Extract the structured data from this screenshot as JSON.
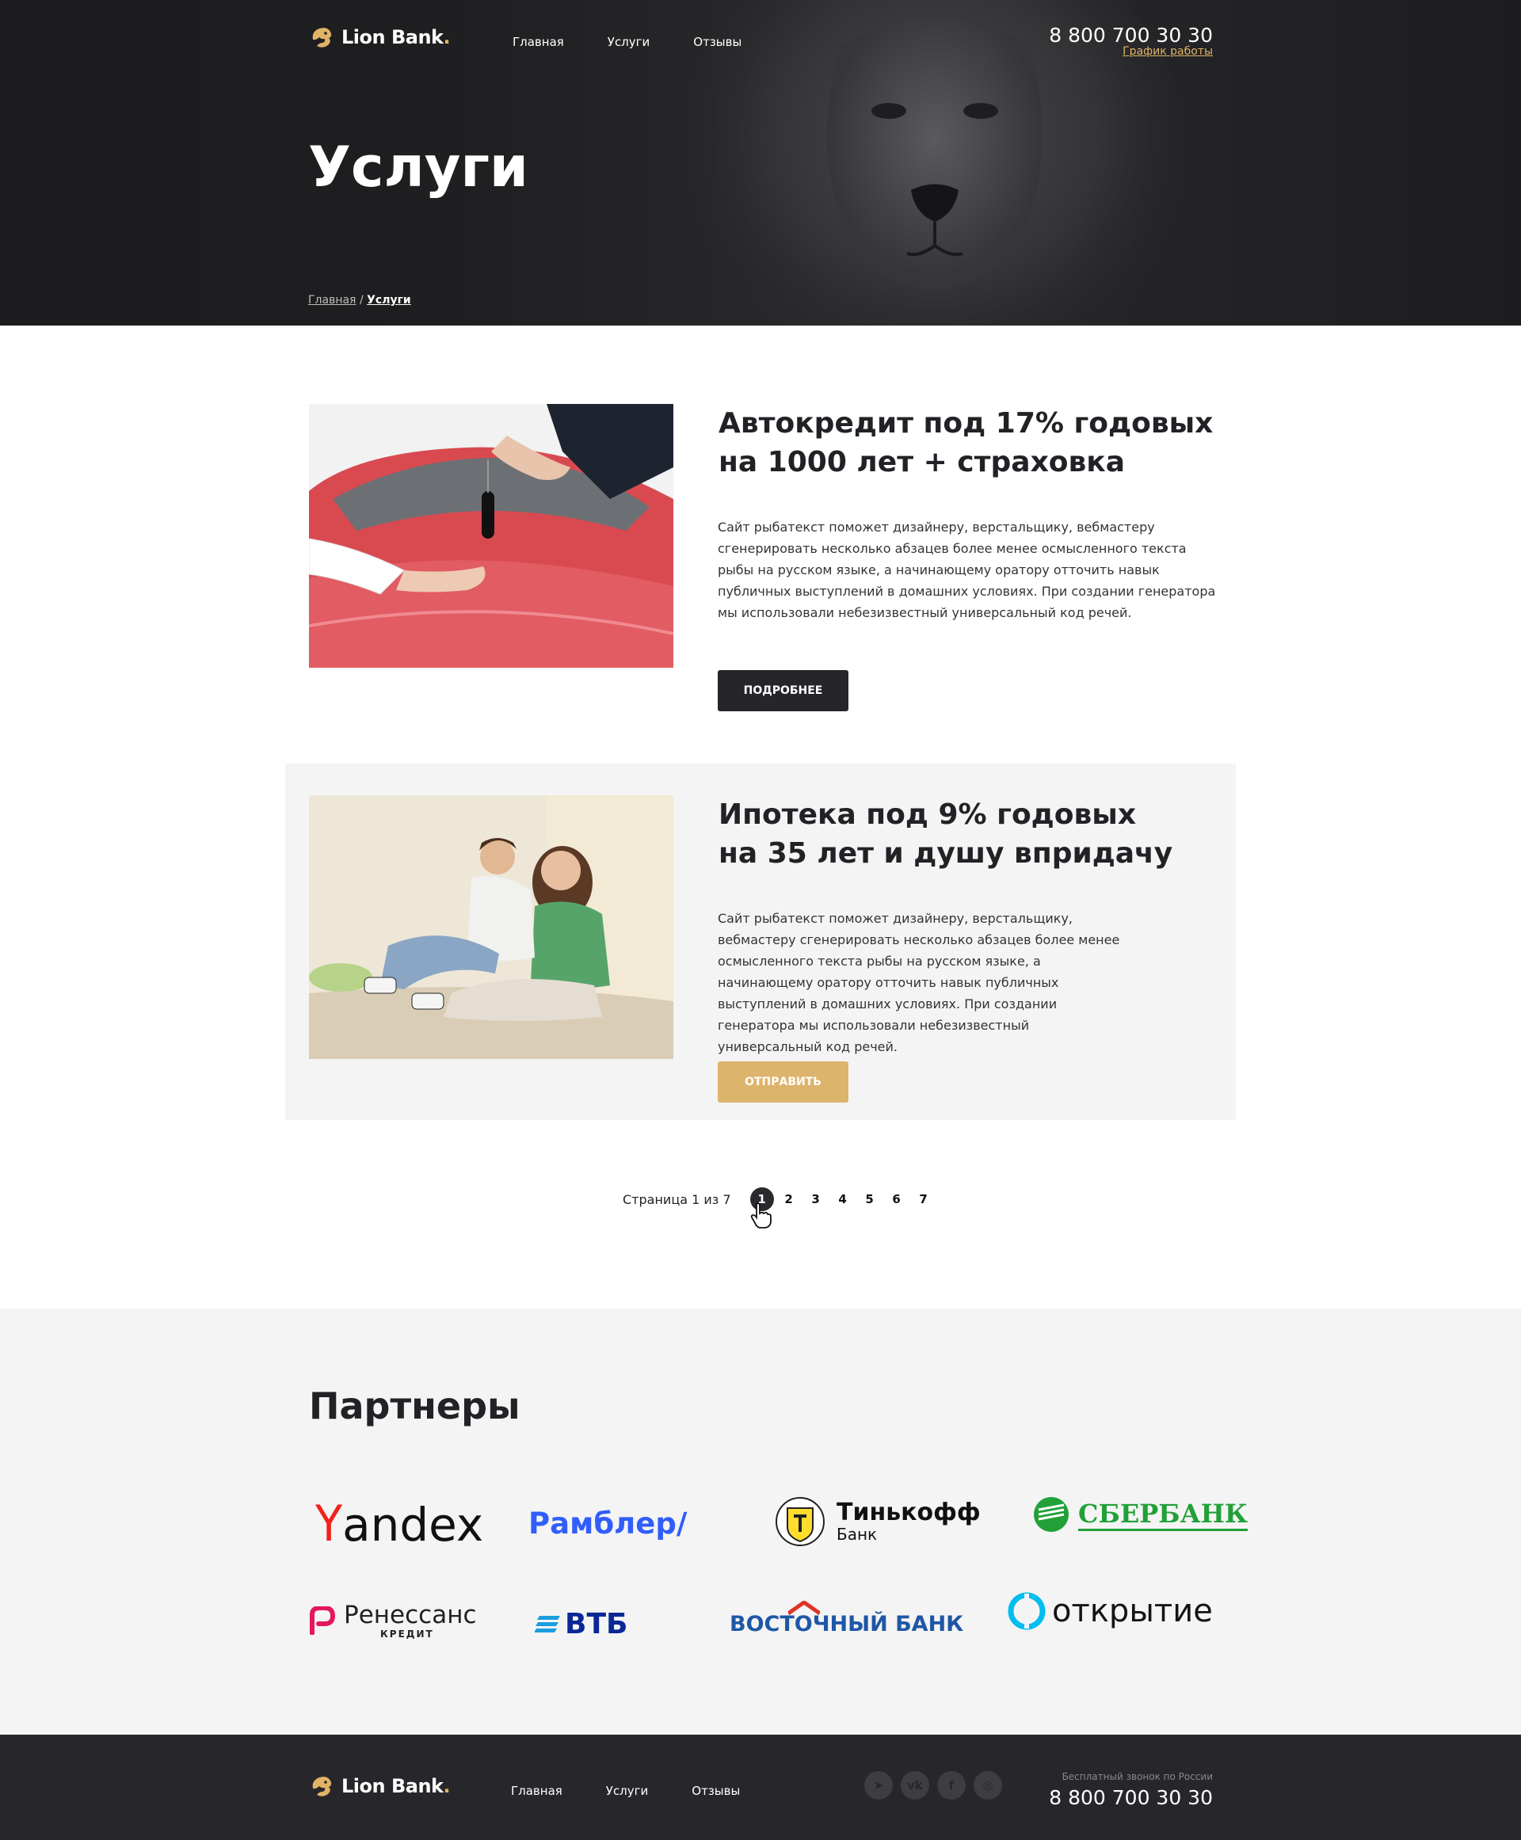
{
  "brand": {
    "name": "Lion Bank",
    "dot": ".",
    "accent": "#e0b366"
  },
  "header": {
    "nav": [
      "Главная",
      "Услуги",
      "Отзывы"
    ],
    "phone": "8 800 700 30 30",
    "schedule_link": "График работы"
  },
  "hero": {
    "title": "Услуги",
    "breadcrumb": {
      "home": "Главная",
      "separator": "/",
      "current": "Услуги"
    }
  },
  "services": [
    {
      "title": "Автокредит под 17% годовых\nна 1000 лет + страховка",
      "text": "Сайт рыбатекст поможет дизайнеру, верстальщику, вебмастеру сгенерировать несколько абзацев более менее осмысленного текста рыбы на русском языке, а начинающему оратору отточить навык публичных выступлений в домашних условиях. При создании генератора мы использовали небезизвестный универсальный код речей.",
      "button": "Подробнее",
      "button_color": "#26262a"
    },
    {
      "title": "Ипотека под 9% годовых\nна 35 лет и душу впридачу",
      "text": "Сайт рыбатекст поможет дизайнеру, верстальщику, вебмастеру сгенерировать несколько абзацев более менее осмысленного текста рыбы на русском языке, а начинающему оратору отточить навык публичных выступлений в домашних условиях. При создании генератора мы использовали небезизвестный универсальный код речей.",
      "button": "Отправить",
      "button_color": "#ddb46c"
    }
  ],
  "pagination": {
    "label": "Страница 1 из 7",
    "pages": [
      "1",
      "2",
      "3",
      "4",
      "5",
      "6",
      "7"
    ],
    "current": 1
  },
  "partners": {
    "title": "Партнеры",
    "logos": {
      "yandex_y": "Y",
      "yandex_rest": "andex",
      "rambler": "Рамблер/",
      "tinkoff_main": "Тинькофф",
      "tinkoff_sub": "Банк",
      "sber": "СБЕРБАНК",
      "renaissance_main": "Ренессанс",
      "renaissance_sub": "КРЕДИТ",
      "vtb": "ВТБ",
      "vostochny": "ВОСТОЧНЫЙ БАНК",
      "otkritie": "открытие"
    }
  },
  "footer": {
    "nav": [
      "Главная",
      "Услуги",
      "Отзывы"
    ],
    "free_call": "Бесплатный звонок по России",
    "phone": "8 800 700 30 30",
    "social_icons": [
      "telegram-icon",
      "vk-icon",
      "facebook-icon",
      "instagram-icon"
    ]
  }
}
